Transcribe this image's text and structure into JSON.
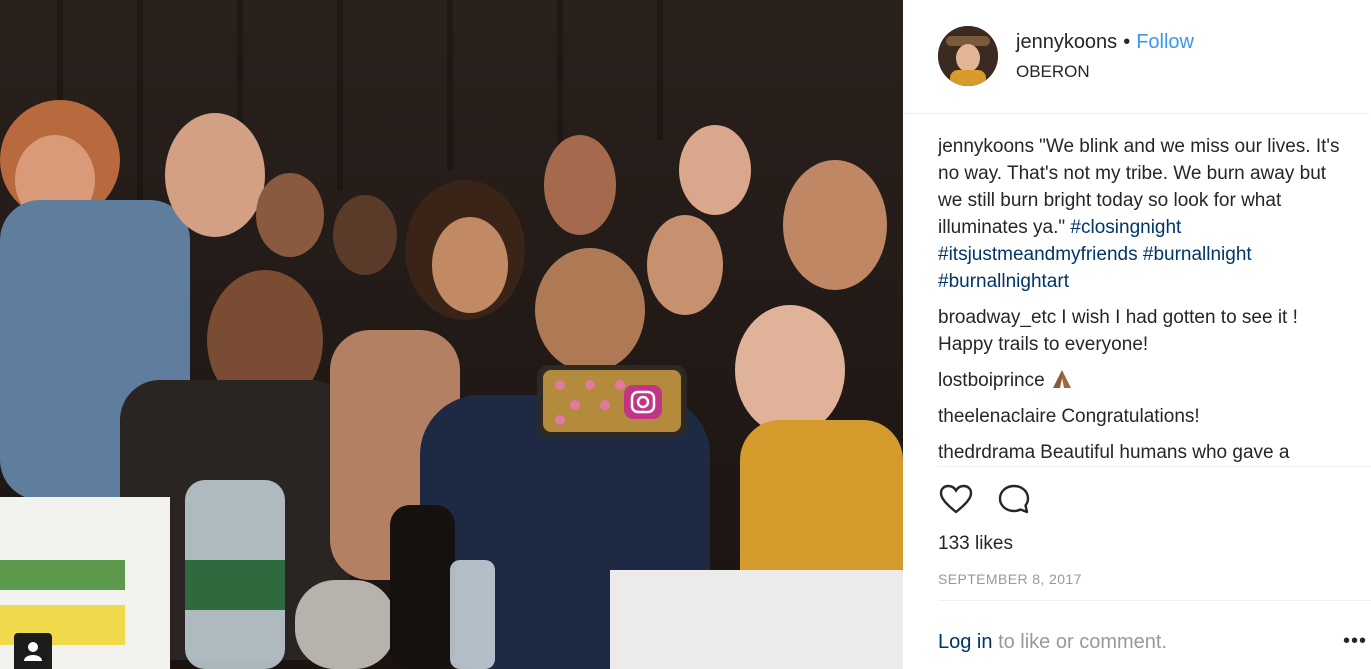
{
  "post": {
    "username": "jennykoons",
    "follow_label": "Follow",
    "separator": "•",
    "location": "OBERON"
  },
  "comments": [
    {
      "user": "jennykoons",
      "text": "\"We blink and we miss our lives. It's no way. That's not my tribe. We burn away but we still burn bright today so look for what illuminates ya.\"",
      "tags": [
        "#closingnight",
        "#itsjustmeandmyfriends",
        "#burnallnight",
        "#burnallnightart"
      ]
    },
    {
      "user": "broadway_etc",
      "text": "I wish I had gotten to see it ! Happy trails to everyone!"
    },
    {
      "user": "lostboiprince",
      "text": ""
    },
    {
      "user": "theelenaclaire",
      "text": "Congratulations!"
    },
    {
      "user": "thedrdrama",
      "text": "Beautiful humans who gave a"
    }
  ],
  "likes_label": "133 likes",
  "date_label": "SEPTEMBER 8, 2017",
  "login": {
    "link": "Log in",
    "rest": "to like or comment."
  },
  "more_label": "•••",
  "icons": {
    "like": "heart-icon",
    "comment": "comment-bubble-icon",
    "user_tag": "person-icon",
    "camera_app": "instagram-icon",
    "reaction": "praying-hands-emoji"
  },
  "colors": {
    "follow": "#3897f0",
    "hashtag": "#003569",
    "muted": "#999999",
    "text": "#262626"
  }
}
